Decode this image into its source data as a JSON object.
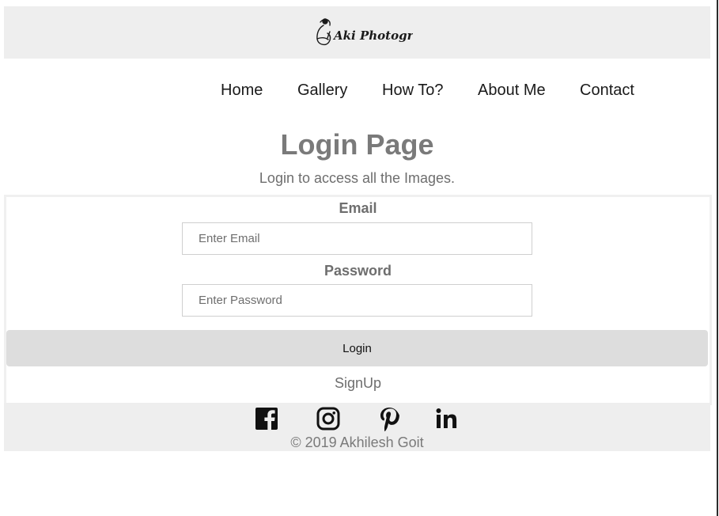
{
  "header": {
    "logo_text": "Aki Photography"
  },
  "nav": {
    "items": [
      {
        "label": "Home"
      },
      {
        "label": "Gallery"
      },
      {
        "label": "How To?"
      },
      {
        "label": "About Me"
      },
      {
        "label": "Contact"
      }
    ]
  },
  "main": {
    "title": "Login Page",
    "subtitle": "Login to access all the Images."
  },
  "form": {
    "email_label": "Email",
    "email_placeholder": "Enter Email",
    "email_value": "",
    "password_label": "Password",
    "password_placeholder": "Enter Password",
    "password_value": "",
    "login_label": "Login",
    "signup_label": "SignUp"
  },
  "footer": {
    "social": [
      {
        "icon": "facebook-icon"
      },
      {
        "icon": "instagram-icon"
      },
      {
        "icon": "pinterest-icon"
      },
      {
        "icon": "linkedin-icon"
      }
    ],
    "copyright": "© 2019 Akhilesh Goit"
  },
  "colors": {
    "header_bg": "#eeeeee",
    "button_bg": "#dddddd",
    "muted_text": "#7a7a7a"
  }
}
